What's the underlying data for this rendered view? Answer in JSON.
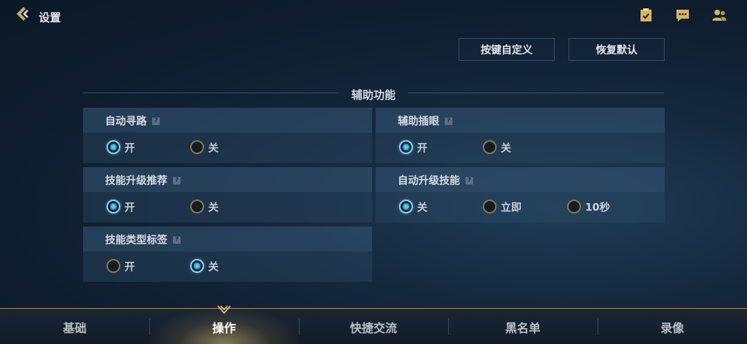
{
  "header": {
    "title": "设置",
    "icons": [
      "back-chevron-icon",
      "task-checklist-icon",
      "chat-bubble-icon",
      "friends-icon"
    ]
  },
  "actions": {
    "customize_keys": "按键自定义",
    "restore_default": "恢复默认"
  },
  "section": {
    "title": "辅助功能"
  },
  "settings": [
    {
      "label": "自动寻路",
      "help": "?",
      "options": [
        "开",
        "关"
      ],
      "selected": "开"
    },
    {
      "label": "辅助插眼",
      "help": "?",
      "options": [
        "开",
        "关"
      ],
      "selected": "开"
    },
    {
      "label": "技能升级推荐",
      "help": "?",
      "options": [
        "开",
        "关"
      ],
      "selected": "开"
    },
    {
      "label": "自动升级技能",
      "help": "?",
      "options": [
        "关",
        "立即",
        "10秒"
      ],
      "selected": "关"
    },
    {
      "label": "技能类型标签",
      "help": "?",
      "options": [
        "开",
        "关"
      ],
      "selected": "关"
    }
  ],
  "tabs": [
    {
      "label": "基础",
      "active": false
    },
    {
      "label": "操作",
      "active": true
    },
    {
      "label": "快捷交流",
      "active": false
    },
    {
      "label": "黑名单",
      "active": false
    },
    {
      "label": "录像",
      "active": false
    }
  ],
  "colors": {
    "accent_gold": "#b79b5a",
    "radio_on": "#6fe0ff",
    "background": "#14283d"
  }
}
